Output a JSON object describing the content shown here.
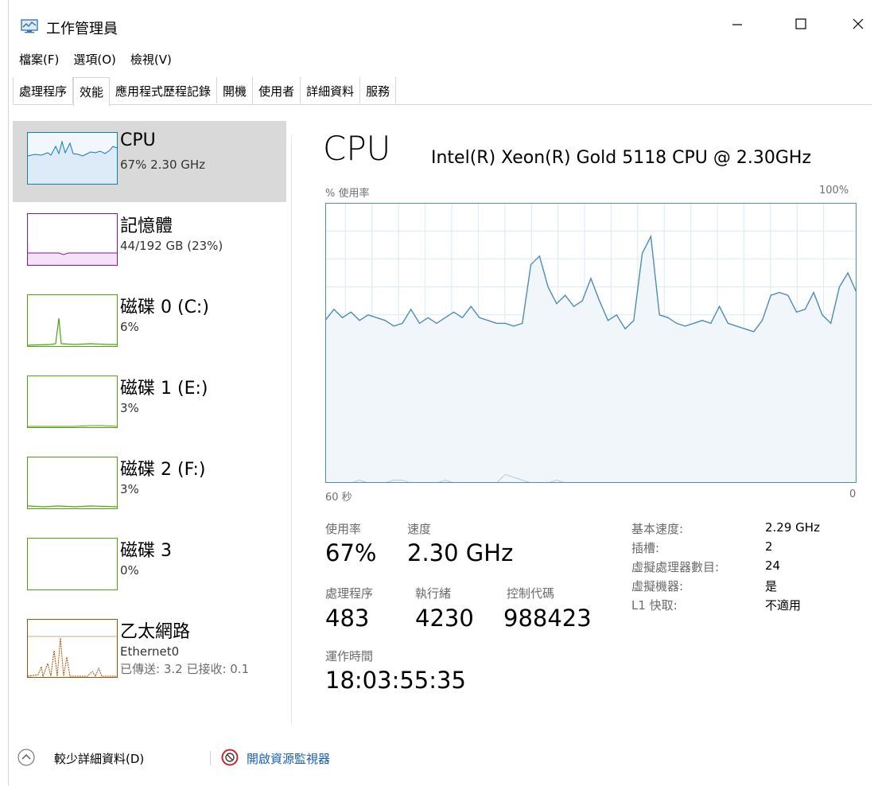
{
  "window": {
    "title": "工作管理員"
  },
  "menu": [
    "檔案(F)",
    "選項(O)",
    "檢視(V)"
  ],
  "tabs": [
    {
      "label": "處理程序",
      "active": false
    },
    {
      "label": "效能",
      "active": true
    },
    {
      "label": "應用程式歷程記錄",
      "active": false
    },
    {
      "label": "開機",
      "active": false
    },
    {
      "label": "使用者",
      "active": false
    },
    {
      "label": "詳細資料",
      "active": false
    },
    {
      "label": "服務",
      "active": false
    }
  ],
  "sidebar": {
    "items": [
      {
        "title": "CPU",
        "sub": "67% 2.30 GHz",
        "sub2": "",
        "color": "#117dbb"
      },
      {
        "title": "記憶體",
        "sub": "44/192 GB (23%)",
        "sub2": "",
        "color": "#8b12ae"
      },
      {
        "title": "磁碟 0 (C:)",
        "sub": "6%",
        "sub2": "",
        "color": "#4da60c"
      },
      {
        "title": "磁碟 1 (E:)",
        "sub": "3%",
        "sub2": "",
        "color": "#4da60c"
      },
      {
        "title": "磁碟 2 (F:)",
        "sub": "3%",
        "sub2": "",
        "color": "#4da60c"
      },
      {
        "title": "磁碟 3",
        "sub": "0%",
        "sub2": "",
        "color": "#4da60c"
      },
      {
        "title": "乙太網路",
        "sub": "Ethernet0",
        "sub2": "已傳送: 3.2 已接收: 0.1",
        "color": "#a74f01"
      }
    ]
  },
  "main": {
    "title": "CPU",
    "model": "Intel(R) Xeon(R) Gold 5118 CPU @ 2.30GHz",
    "usage_label": "% 使用率",
    "max_label": "100%",
    "time_label": "60 秒",
    "min_label": "0",
    "stats": {
      "utilization_label": "使用率",
      "utilization": "67%",
      "speed_label": "速度",
      "speed": "2.30 GHz",
      "processes_label": "處理程序",
      "processes": "483",
      "threads_label": "執行緒",
      "threads": "4230",
      "handles_label": "控制代碼",
      "handles": "988423",
      "uptime_label": "運作時間",
      "uptime": "18:03:55:35"
    },
    "info": [
      {
        "label": "基本速度:",
        "value": "2.29 GHz"
      },
      {
        "label": "插槽:",
        "value": "2"
      },
      {
        "label": "虛擬處理器數目:",
        "value": "24"
      },
      {
        "label": "虛擬機器:",
        "value": "是"
      },
      {
        "label": "L1 快取:",
        "value": "不適用"
      }
    ]
  },
  "footer": {
    "fewer_details": "較少詳細資料(D)",
    "resource_monitor": "開啟資源監視器"
  },
  "chart_data": {
    "type": "area",
    "xlim": [
      60,
      0
    ],
    "ylim": [
      0,
      100
    ],
    "grid": true,
    "series": [
      {
        "values": [
          58,
          62,
          59,
          61,
          58,
          60,
          59,
          58,
          56,
          57,
          62,
          57,
          59,
          57,
          59,
          61,
          59,
          63,
          59,
          58,
          57,
          57,
          56,
          57,
          78,
          81,
          70,
          64,
          67,
          63,
          65,
          73,
          65,
          58,
          60,
          55,
          58,
          82,
          88,
          60,
          59,
          57,
          56,
          57,
          58,
          57,
          63,
          57,
          56,
          55,
          54,
          58,
          67,
          68,
          67,
          61,
          62,
          68,
          60,
          57,
          70,
          75,
          68
        ]
      },
      {
        "values": [
          0,
          0,
          0,
          0,
          1,
          0,
          0,
          0,
          1,
          1,
          0,
          0,
          0,
          0,
          1,
          0,
          0,
          0,
          0,
          0,
          0,
          3,
          2,
          1,
          0,
          0,
          0,
          1,
          0,
          0,
          0,
          0,
          0,
          0,
          0,
          0,
          0,
          0,
          0,
          0,
          0,
          0,
          0,
          0,
          0,
          0,
          0,
          0,
          0,
          0,
          0,
          0,
          0,
          0,
          0,
          0,
          0,
          0,
          0,
          0,
          0,
          0,
          0
        ]
      }
    ]
  }
}
